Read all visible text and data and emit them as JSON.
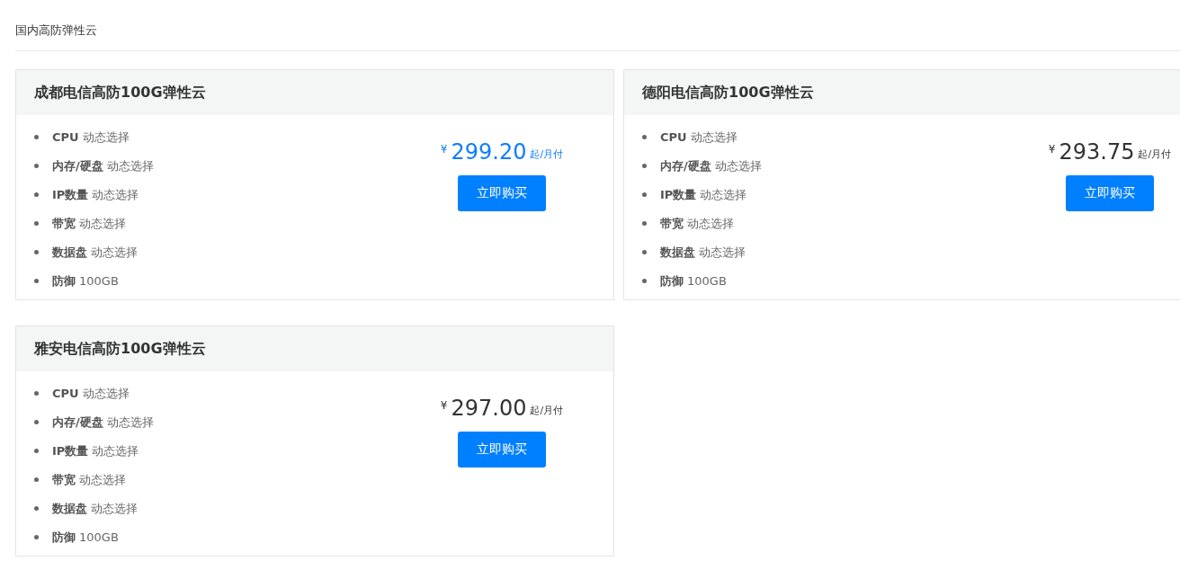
{
  "section_title": "国内高防弹性云",
  "products": [
    {
      "name": "成都电信高防100G弹性云",
      "highlighted": true,
      "specs": [
        {
          "label": "CPU",
          "value": "动态选择"
        },
        {
          "label": "内存/硬盘",
          "value": "动态选择"
        },
        {
          "label": "IP数量",
          "value": "动态选择"
        },
        {
          "label": "带宽",
          "value": "动态选择"
        },
        {
          "label": "数据盘",
          "value": "动态选择"
        },
        {
          "label": "防御",
          "value": "100GB"
        }
      ],
      "currency": "¥",
      "price": "299.20",
      "unit": "起/月付",
      "button": "立即购买"
    },
    {
      "name": "德阳电信高防100G弹性云",
      "highlighted": false,
      "specs": [
        {
          "label": "CPU",
          "value": "动态选择"
        },
        {
          "label": "内存/硬盘",
          "value": "动态选择"
        },
        {
          "label": "IP数量",
          "value": "动态选择"
        },
        {
          "label": "带宽",
          "value": "动态选择"
        },
        {
          "label": "数据盘",
          "value": "动态选择"
        },
        {
          "label": "防御",
          "value": "100GB"
        }
      ],
      "currency": "¥",
      "price": "293.75",
      "unit": "起/月付",
      "button": "立即购买"
    },
    {
      "name": "雅安电信高防100G弹性云",
      "highlighted": false,
      "specs": [
        {
          "label": "CPU",
          "value": "动态选择"
        },
        {
          "label": "内存/硬盘",
          "value": "动态选择"
        },
        {
          "label": "IP数量",
          "value": "动态选择"
        },
        {
          "label": "带宽",
          "value": "动态选择"
        },
        {
          "label": "数据盘",
          "value": "动态选择"
        },
        {
          "label": "防御",
          "value": "100GB"
        }
      ],
      "currency": "¥",
      "price": "297.00",
      "unit": "起/月付",
      "button": "立即购买"
    }
  ]
}
